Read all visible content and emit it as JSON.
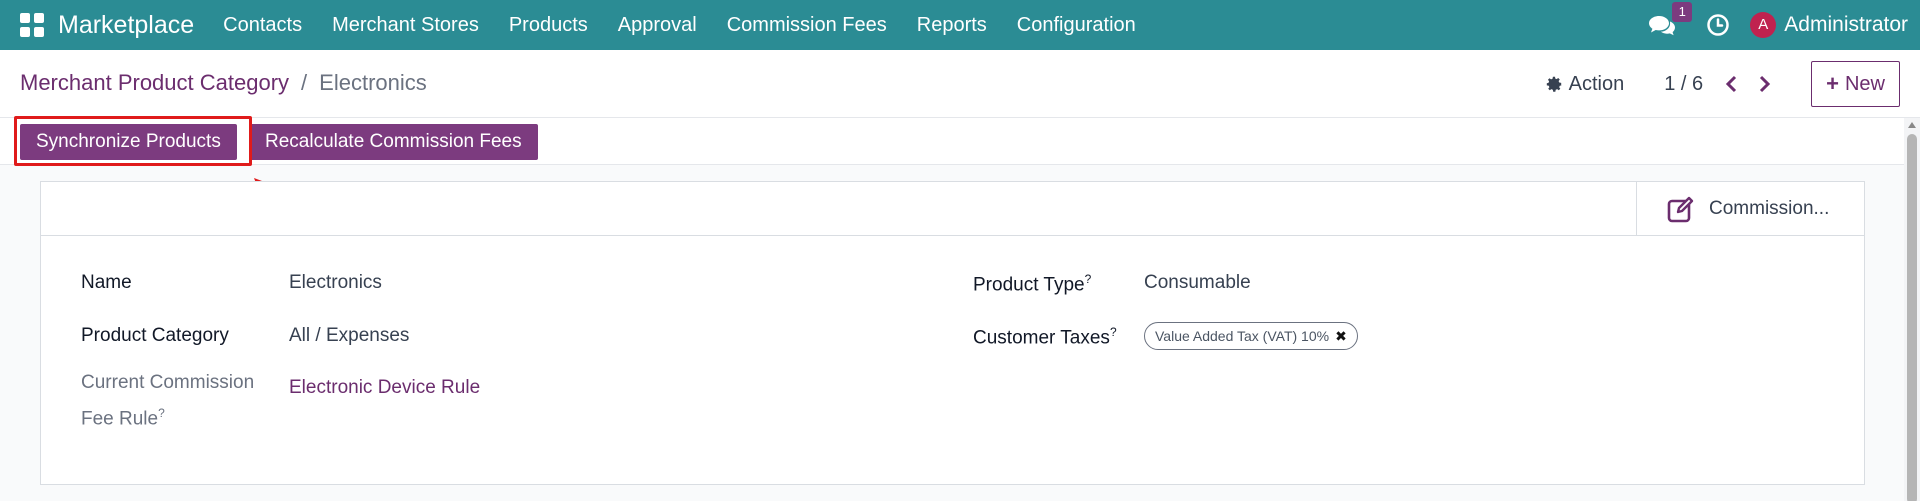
{
  "navbar": {
    "app_name": "Marketplace",
    "menu": [
      "Contacts",
      "Merchant Stores",
      "Products",
      "Approval",
      "Commission Fees",
      "Reports",
      "Configuration"
    ],
    "chat_count": "1",
    "avatar_letter": "A",
    "user_name": "Administrator",
    "bg_color": "#2b8c94"
  },
  "breadcrumb": {
    "parent": "Merchant Product Category",
    "separator": "/",
    "current": "Electronics"
  },
  "control_panel": {
    "action_label": "Action",
    "pager": "1 / 6",
    "new_label": "New"
  },
  "header_buttons": {
    "sync": "Synchronize Products",
    "recalc": "Recalculate Commission Fees",
    "accent_color": "#7c3b7f"
  },
  "stat_button": {
    "label": "Commission..."
  },
  "form": {
    "name_label": "Name",
    "name_value": "Electronics",
    "category_label": "Product Category",
    "category_value": "All / Expenses",
    "rule_label_line1": "Current Commission",
    "rule_label_line2": "Fee Rule",
    "rule_value": "Electronic Device Rule",
    "type_label": "Product Type",
    "type_value": "Consumable",
    "taxes_label": "Customer Taxes",
    "tax_tag": "Value Added Tax (VAT) 10%",
    "help_mark": "?"
  }
}
